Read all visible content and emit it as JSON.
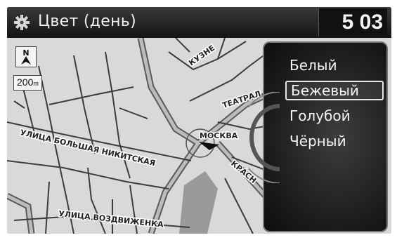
{
  "header": {
    "title": "Цвет (день)",
    "clock": "5 03",
    "icon": "gear-icon"
  },
  "map": {
    "scale_value": "200",
    "scale_unit": "m",
    "compass_label": "N",
    "labels": {
      "kuzne": "КУЗНЕ",
      "teatral": "ТЕАТРАЛ",
      "moskva": "МОСКВА",
      "bolshaya_nikitskaya": "УЛИЦА БОЛЬШАЯ НИКИТСКАЯ",
      "krasn": "КРАСН",
      "vozdvizhenka": "УЛИЦА ВОЗДВИЖЕНКА"
    }
  },
  "color_options": {
    "items": [
      {
        "label": "Белый",
        "selected": false
      },
      {
        "label": "Бежевый",
        "selected": true
      },
      {
        "label": "Голубой",
        "selected": false
      },
      {
        "label": "Чёрный",
        "selected": false
      }
    ]
  },
  "colors": {
    "map_background": "#d9d9d9",
    "major_road": "#6e6e6e",
    "minor_road": "#3f3f3f",
    "panel_border": "#777777",
    "text_light": "#f4f4f4"
  }
}
